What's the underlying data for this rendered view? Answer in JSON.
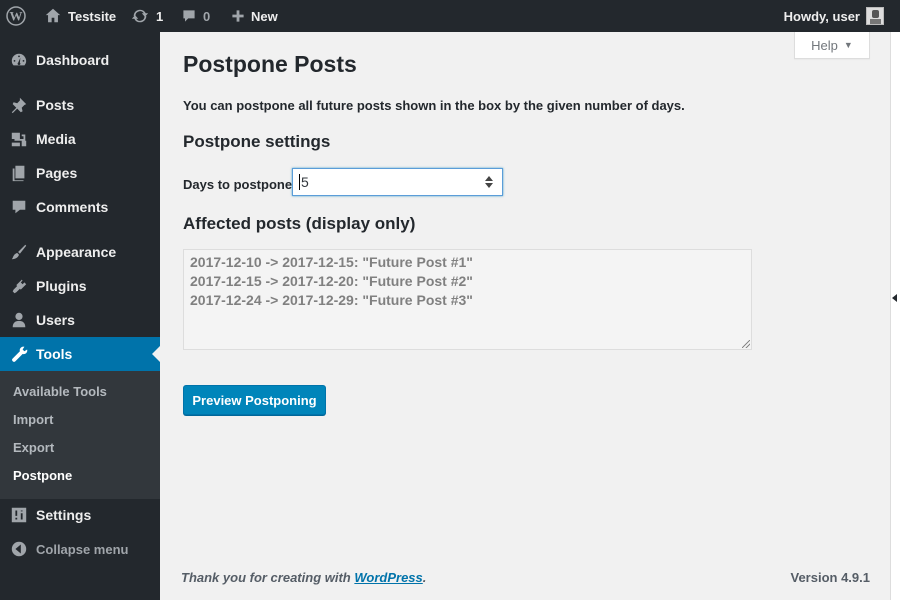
{
  "admin_bar": {
    "site_name": "Testsite",
    "updates_count": "1",
    "comments_count": "0",
    "new_label": "New",
    "howdy": "Howdy, user"
  },
  "sidebar": {
    "items": [
      {
        "label": "Dashboard",
        "icon": "dashboard-icon"
      },
      {
        "label": "Posts",
        "icon": "pin-icon"
      },
      {
        "label": "Media",
        "icon": "media-icon"
      },
      {
        "label": "Pages",
        "icon": "pages-icon"
      },
      {
        "label": "Comments",
        "icon": "comment-icon"
      },
      {
        "label": "Appearance",
        "icon": "brush-icon"
      },
      {
        "label": "Plugins",
        "icon": "plug-icon"
      },
      {
        "label": "Users",
        "icon": "user-icon"
      },
      {
        "label": "Tools",
        "icon": "wrench-icon"
      },
      {
        "label": "Settings",
        "icon": "sliders-icon"
      }
    ],
    "tools_submenu": [
      "Available Tools",
      "Import",
      "Export",
      "Postpone"
    ],
    "collapse_label": "Collapse menu"
  },
  "help_label": "Help",
  "main": {
    "title": "Postpone Posts",
    "intro": "You can postpone all future posts shown in the box by the given number of days.",
    "settings_heading": "Postpone settings",
    "days_label": "Days to postpone:",
    "days_value": "5",
    "affected_heading": "Affected posts (display only)",
    "affected_lines": [
      "2017-12-10 -> 2017-12-15: \"Future Post #1\"",
      "2017-12-15 -> 2017-12-20: \"Future Post #2\"",
      "2017-12-24 -> 2017-12-29: \"Future Post #3\""
    ],
    "preview_button": "Preview Postponing"
  },
  "footer": {
    "thanks_prefix": "Thank you for creating with ",
    "wordpress_link": "WordPress",
    "thanks_suffix": ".",
    "version": "Version 4.9.1"
  },
  "colors": {
    "admin_bar_bg": "#23282d",
    "current_menu_bg": "#0073aa",
    "button_bg": "#0085ba",
    "page_bg": "#f1f1f1"
  }
}
